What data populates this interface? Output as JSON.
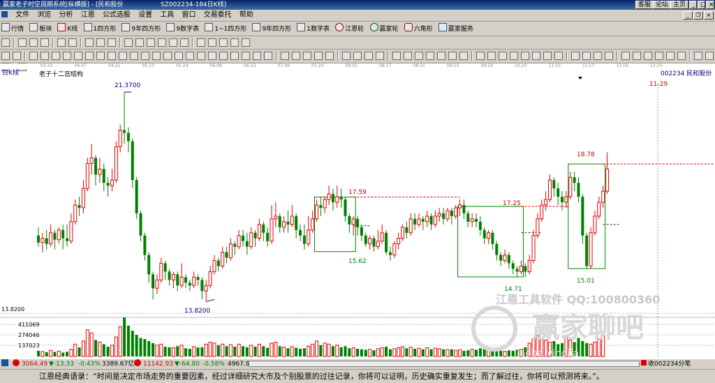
{
  "window": {
    "title": "赢家老子时空周期系统[纵横版] - [民和股份",
    "symbol_info": "SZ002234-184日K线]",
    "right_buttons": [
      "客服",
      "论坛",
      "主页"
    ]
  },
  "menu": [
    "文件",
    "浏览",
    "分析",
    "江恩",
    "公式选股",
    "设置",
    "工具",
    "窗口",
    "交易委托",
    "帮助"
  ],
  "toolbar1": [
    "行情",
    "板块",
    "K线",
    "1四方形",
    "9年四方形",
    "9数字表",
    "1~1四方形",
    "9年四方形",
    "1数字表",
    "江恩轮",
    "赢家轮",
    "六角形",
    "赢家服务"
  ],
  "date_axis": [
    "03-22",
    "04-07",
    "04-21",
    "05-10",
    "05-24",
    "06-08",
    "06-22",
    "07-06",
    "07-20",
    "08-03",
    "08-17",
    "08-31",
    "09-15",
    "09-29",
    "10-20",
    "11-03",
    "11-17",
    "12-03",
    "12-15"
  ],
  "chart_data": {
    "type": "candlestick",
    "period_label": "日K线",
    "study_title": "老子十二宫结构",
    "stock_label": "002234 民和股份",
    "future_date": "11-29",
    "annotations": {
      "high": "21.3700",
      "low": "13.8200",
      "p1": "17.59",
      "p2": "15.62",
      "p3": "17.25",
      "p4": "14.71",
      "p5": "18.78",
      "p6": "15.01"
    },
    "price_axis_label": "13.8200",
    "volume_axis": [
      "411069",
      "274046",
      "137023"
    ],
    "candles": [
      [
        16.2,
        15.95,
        15.8,
        16.5
      ],
      [
        15.95,
        16.1,
        15.6,
        16.3
      ],
      [
        16.1,
        15.9,
        15.7,
        16.4
      ],
      [
        15.9,
        16.3,
        15.8,
        16.6
      ],
      [
        16.3,
        16.05,
        15.7,
        16.4
      ],
      [
        16.05,
        16.4,
        15.9,
        16.5
      ],
      [
        16.4,
        16.1,
        15.7,
        16.6
      ],
      [
        16.1,
        16.0,
        15.8,
        16.6
      ],
      [
        16.0,
        16.7,
        15.9,
        17.0
      ],
      [
        16.7,
        17.3,
        16.6,
        17.5
      ],
      [
        17.3,
        17.2,
        16.9,
        17.6
      ],
      [
        17.2,
        17.9,
        17.0,
        18.2
      ],
      [
        17.9,
        18.8,
        17.8,
        19.0
      ],
      [
        18.8,
        19.0,
        18.4,
        19.5
      ],
      [
        19.0,
        18.4,
        18.0,
        19.1
      ],
      [
        18.4,
        18.6,
        18.1,
        19.0
      ],
      [
        18.6,
        18.1,
        17.8,
        18.8
      ],
      [
        18.1,
        18.0,
        17.6,
        18.3
      ],
      [
        18.0,
        18.2,
        17.8,
        18.6
      ],
      [
        18.2,
        19.4,
        18.1,
        19.6
      ],
      [
        19.4,
        20.0,
        19.2,
        20.2
      ],
      [
        20.0,
        19.9,
        19.5,
        21.37
      ],
      [
        19.9,
        19.6,
        19.2,
        20.1
      ],
      [
        19.6,
        18.2,
        17.9,
        19.7
      ],
      [
        18.2,
        17.0,
        16.8,
        18.3
      ],
      [
        17.0,
        16.2,
        16.0,
        17.1
      ],
      [
        16.2,
        15.5,
        15.3,
        16.3
      ],
      [
        15.5,
        14.8,
        14.5,
        15.6
      ],
      [
        14.8,
        14.3,
        13.9,
        14.9
      ],
      [
        14.3,
        14.6,
        14.1,
        14.8
      ],
      [
        14.6,
        15.2,
        14.5,
        15.4
      ],
      [
        15.2,
        14.9,
        14.6,
        15.3
      ],
      [
        14.9,
        14.6,
        14.4,
        15.0
      ],
      [
        14.6,
        14.8,
        14.3,
        14.9
      ],
      [
        14.8,
        14.4,
        14.2,
        14.9
      ],
      [
        14.4,
        14.7,
        14.3,
        15.2
      ],
      [
        14.7,
        14.5,
        14.3,
        14.8
      ],
      [
        14.5,
        14.4,
        14.2,
        14.6
      ],
      [
        14.4,
        14.7,
        14.3,
        14.9
      ],
      [
        14.7,
        14.6,
        14.4,
        14.8
      ],
      [
        14.6,
        14.2,
        13.9,
        14.7
      ],
      [
        14.2,
        14.4,
        13.82,
        14.6
      ],
      [
        14.4,
        14.9,
        14.3,
        15.1
      ],
      [
        14.9,
        15.3,
        14.8,
        15.5
      ],
      [
        15.3,
        15.1,
        14.9,
        15.4
      ],
      [
        15.1,
        15.6,
        15.0,
        15.8
      ],
      [
        15.6,
        15.4,
        15.2,
        15.8
      ],
      [
        15.4,
        15.9,
        15.3,
        16.1
      ],
      [
        15.9,
        15.8,
        15.5,
        16.0
      ],
      [
        15.8,
        16.2,
        15.7,
        16.4
      ],
      [
        16.2,
        16.0,
        15.8,
        16.4
      ],
      [
        16.0,
        15.8,
        15.5,
        16.3
      ],
      [
        15.8,
        16.3,
        15.7,
        16.5
      ],
      [
        16.3,
        16.1,
        15.8,
        16.4
      ],
      [
        16.1,
        16.6,
        16.0,
        16.8
      ],
      [
        16.6,
        16.3,
        16.0,
        16.7
      ],
      [
        16.3,
        16.0,
        15.8,
        16.5
      ],
      [
        16.0,
        16.8,
        15.9,
        17.3
      ],
      [
        16.8,
        16.9,
        16.5,
        17.4
      ],
      [
        16.9,
        16.5,
        16.3,
        17.0
      ],
      [
        16.5,
        16.7,
        16.3,
        16.9
      ],
      [
        16.7,
        16.6,
        16.3,
        17.1
      ],
      [
        16.6,
        16.9,
        16.5,
        17.3
      ],
      [
        16.9,
        16.4,
        16.1,
        17.0
      ],
      [
        16.4,
        16.2,
        16.0,
        16.6
      ],
      [
        16.2,
        15.9,
        15.7,
        16.6
      ],
      [
        15.9,
        16.4,
        15.8,
        16.9
      ],
      [
        16.4,
        16.8,
        16.3,
        17.1
      ],
      [
        16.8,
        17.3,
        16.7,
        17.5
      ],
      [
        17.3,
        17.2,
        16.9,
        17.6
      ],
      [
        17.2,
        17.5,
        17.0,
        17.6
      ],
      [
        17.5,
        17.7,
        17.3,
        18.0
      ],
      [
        17.7,
        17.4,
        17.1,
        17.9
      ],
      [
        17.4,
        17.6,
        17.2,
        18.0
      ],
      [
        17.6,
        17.5,
        17.2,
        17.9
      ],
      [
        17.5,
        16.9,
        16.7,
        17.6
      ],
      [
        16.9,
        16.6,
        16.3,
        17.0
      ],
      [
        16.6,
        16.8,
        16.2,
        16.9
      ],
      [
        16.8,
        16.5,
        16.2,
        16.9
      ],
      [
        16.5,
        16.2,
        16.0,
        16.6
      ],
      [
        16.2,
        15.9,
        15.8,
        16.3
      ],
      [
        15.9,
        16.1,
        15.7,
        16.2
      ],
      [
        16.1,
        15.8,
        15.62,
        16.2
      ],
      [
        15.8,
        16.0,
        15.7,
        16.4
      ],
      [
        16.0,
        16.3,
        15.9,
        16.6
      ],
      [
        16.3,
        15.6,
        15.5,
        16.4
      ],
      [
        15.6,
        15.5,
        15.3,
        15.8
      ],
      [
        15.5,
        15.9,
        15.4,
        16.0
      ],
      [
        15.9,
        16.1,
        15.7,
        16.3
      ],
      [
        16.1,
        16.5,
        16.0,
        16.6
      ],
      [
        16.5,
        16.3,
        16.1,
        16.7
      ],
      [
        16.3,
        16.8,
        16.2,
        17.0
      ],
      [
        16.8,
        16.6,
        16.4,
        17.0
      ],
      [
        16.6,
        16.8,
        16.5,
        17.0
      ],
      [
        16.8,
        16.7,
        16.4,
        16.9
      ],
      [
        16.7,
        16.9,
        16.5,
        17.1
      ],
      [
        16.9,
        16.6,
        16.4,
        17.0
      ],
      [
        16.6,
        16.9,
        16.5,
        17.1
      ],
      [
        16.9,
        17.0,
        16.7,
        17.2
      ],
      [
        17.0,
        16.8,
        16.6,
        17.2
      ],
      [
        16.8,
        17.1,
        16.7,
        17.2
      ],
      [
        17.1,
        16.9,
        16.6,
        17.2
      ],
      [
        16.9,
        17.2,
        16.8,
        17.3
      ],
      [
        17.2,
        17.3,
        16.9,
        17.5
      ],
      [
        17.3,
        17.0,
        16.8,
        17.5
      ],
      [
        17.0,
        16.7,
        16.5,
        17.1
      ],
      [
        16.7,
        16.8,
        16.5,
        17.0
      ],
      [
        16.8,
        16.7,
        16.5,
        17.0
      ],
      [
        16.7,
        16.4,
        16.2,
        16.9
      ],
      [
        16.4,
        16.1,
        15.9,
        16.5
      ],
      [
        16.1,
        16.3,
        15.9,
        16.4
      ],
      [
        16.3,
        15.9,
        15.7,
        16.4
      ],
      [
        15.9,
        15.5,
        15.3,
        16.0
      ],
      [
        15.5,
        15.3,
        15.1,
        15.6
      ],
      [
        15.3,
        15.5,
        15.2,
        15.7
      ],
      [
        15.5,
        15.2,
        15.0,
        15.6
      ],
      [
        15.2,
        15.0,
        14.8,
        15.3
      ],
      [
        15.0,
        14.9,
        14.71,
        15.1
      ],
      [
        14.9,
        15.1,
        14.8,
        15.3
      ],
      [
        15.1,
        14.9,
        14.7,
        15.2
      ],
      [
        14.9,
        15.3,
        14.8,
        15.5
      ],
      [
        15.3,
        16.2,
        15.2,
        16.4
      ],
      [
        16.2,
        16.8,
        16.1,
        17.0
      ],
      [
        16.8,
        17.3,
        16.7,
        17.5
      ],
      [
        17.3,
        17.5,
        17.1,
        17.8
      ],
      [
        17.5,
        18.2,
        17.4,
        18.4
      ],
      [
        18.2,
        17.9,
        17.6,
        18.3
      ],
      [
        17.9,
        17.6,
        17.3,
        18.1
      ],
      [
        17.6,
        17.4,
        17.1,
        17.8
      ],
      [
        17.4,
        17.6,
        17.2,
        17.8
      ],
      [
        17.6,
        18.3,
        17.5,
        18.5
      ],
      [
        18.3,
        18.1,
        17.8,
        18.5
      ],
      [
        18.1,
        17.6,
        17.4,
        18.3
      ],
      [
        17.6,
        16.2,
        15.9,
        17.7
      ],
      [
        16.2,
        15.1,
        15.01,
        16.3
      ],
      [
        15.1,
        16.3,
        15.0,
        16.5
      ],
      [
        16.3,
        16.9,
        16.2,
        17.1
      ],
      [
        16.9,
        17.4,
        16.8,
        17.6
      ],
      [
        17.4,
        17.8,
        17.2,
        18.0
      ],
      [
        17.8,
        18.6,
        17.7,
        19.2
      ]
    ],
    "volume": [
      55,
      48,
      42,
      60,
      44,
      52,
      38,
      46,
      70,
      120,
      88,
      150,
      260,
      230,
      160,
      140,
      120,
      95,
      110,
      190,
      290,
      380,
      300,
      250,
      210,
      180,
      170,
      150,
      130,
      110,
      120,
      95,
      90,
      85,
      100,
      110,
      80,
      75,
      95,
      88,
      90,
      120,
      140,
      130,
      110,
      120,
      100,
      115,
      95,
      120,
      100,
      90,
      110,
      95,
      120,
      100,
      85,
      130,
      140,
      100,
      90,
      80,
      95,
      85,
      75,
      80,
      100,
      120,
      150,
      110,
      130,
      120,
      100,
      110,
      90,
      100,
      80,
      85,
      75,
      70,
      65,
      70,
      60,
      75,
      85,
      95,
      70,
      75,
      85,
      95,
      80,
      90,
      75,
      80,
      70,
      85,
      70,
      80,
      75,
      70,
      65,
      70,
      60,
      65,
      55,
      60,
      70,
      65,
      80,
      75,
      90,
      70,
      60,
      55,
      50,
      60,
      55,
      65,
      70,
      90,
      130,
      170,
      200,
      180,
      160,
      140,
      150,
      120,
      130,
      200,
      160,
      140,
      180,
      150,
      130,
      120,
      140,
      170,
      210
    ]
  },
  "status": {
    "sh_index": "3064.49",
    "sh_change": "▼-13.33",
    "sh_pct": "-0.43%",
    "sh_amount": "3389.67亿",
    "sz_index": "11142.93",
    "sz_change": "▼-64.80",
    "sz_pct": "-0.58%",
    "sz_amount": "4967.9",
    "right_text": "收002234分笔"
  },
  "watermark": {
    "line1": "江恩工具软件  QQ:100800360",
    "line2": "赢家聊吧",
    "line3": "jiaoba.yingjia"
  },
  "quote_bar": "江恩经典语录：“时间是决定市场走势的重要因素，经过详细研究大市及个别股票的过往记录，你将可以证明，历史确实重复发生；而了解过往，你将可以预测将来。”。"
}
